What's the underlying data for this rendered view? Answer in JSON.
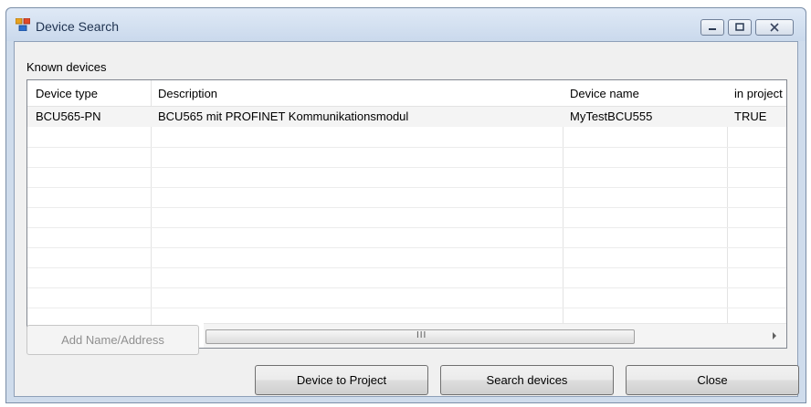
{
  "window": {
    "title": "Device Search"
  },
  "section": {
    "label": "Known devices"
  },
  "table": {
    "columns": [
      "Device type",
      "Description",
      "Device name",
      "in project"
    ],
    "rows": [
      {
        "device_type": "BCU565-PN",
        "description": "BCU565 mit PROFINET Kommunikationsmodul",
        "device_name": "MyTestBCU555",
        "in_project": "TRUE"
      }
    ]
  },
  "scrollbar": {
    "grip": "III"
  },
  "buttons": {
    "add_name_address": "Add Name/Address",
    "device_to_project": "Device to Project",
    "search_devices": "Search devices",
    "close": "Close"
  },
  "icons": {
    "app": "network-devices-icon",
    "minimize": "minimize-icon",
    "maximize": "maximize-icon",
    "close": "close-icon"
  }
}
